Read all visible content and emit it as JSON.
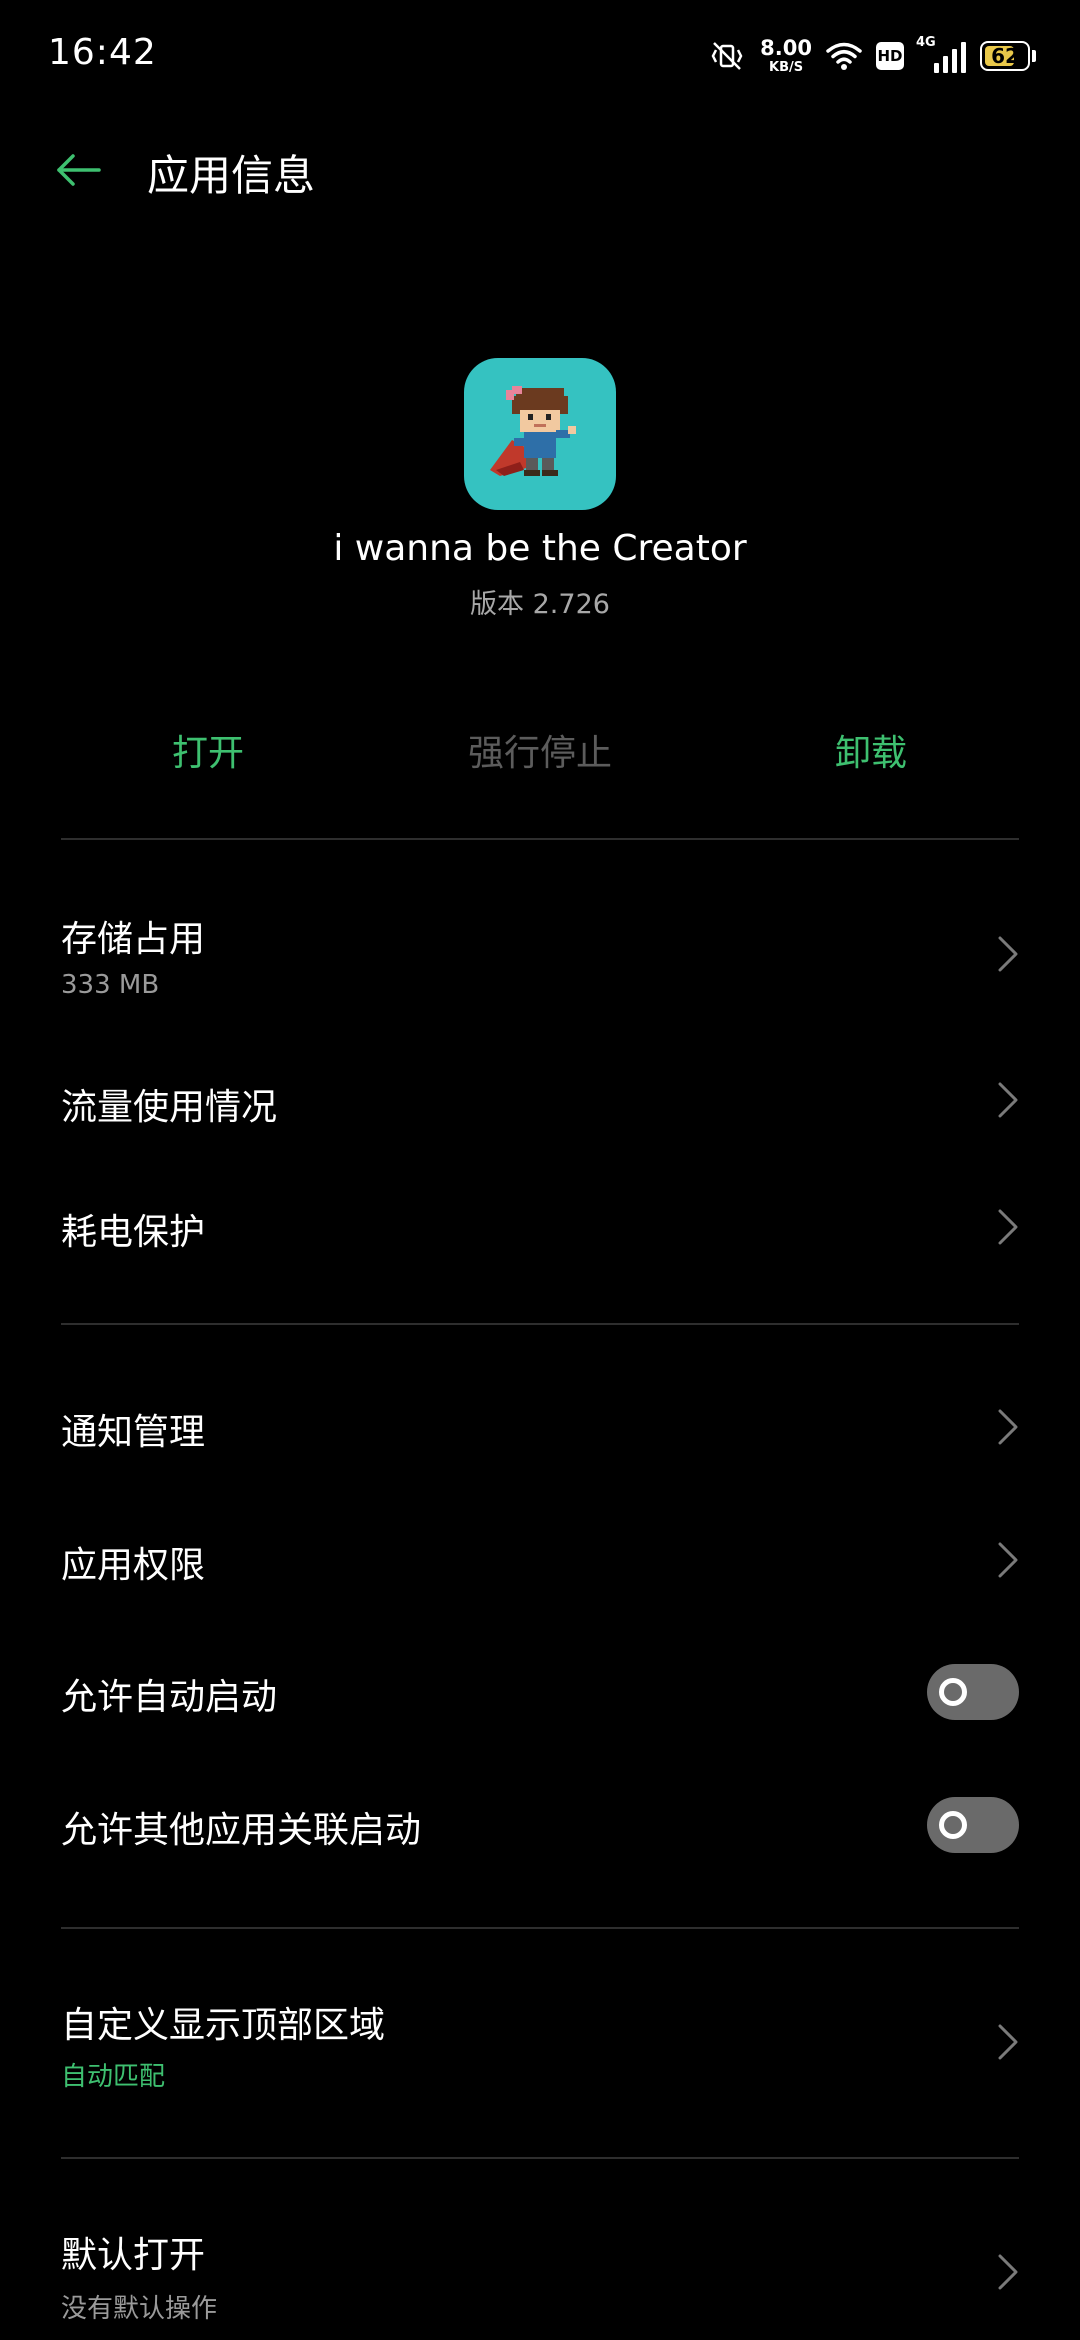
{
  "status_bar": {
    "time": "16:42",
    "net_speed_value": "8.00",
    "net_speed_unit": "KB/S",
    "hd_label": "HD",
    "network_type": "4G",
    "battery_level": "62"
  },
  "header": {
    "title": "应用信息"
  },
  "app": {
    "name": "i wanna be the Creator",
    "version": "版本 2.726"
  },
  "actions": {
    "open": "打开",
    "force_stop": "强行停止",
    "uninstall": "卸载"
  },
  "rows": {
    "storage": {
      "title": "存储占用",
      "subtitle": "333 MB"
    },
    "data_usage": {
      "title": "流量使用情况"
    },
    "battery_protect": {
      "title": "耗电保护"
    },
    "notifications": {
      "title": "通知管理"
    },
    "permissions": {
      "title": "应用权限"
    },
    "auto_start": {
      "title": "允许自动启动",
      "enabled": false
    },
    "associated_start": {
      "title": "允许其他应用关联启动",
      "enabled": false
    },
    "top_area": {
      "title": "自定义显示顶部区域",
      "subtitle": "自动匹配"
    },
    "default_open": {
      "title": "默认打开",
      "subtitle": "没有默认操作"
    }
  },
  "colors": {
    "accent": "#3ec070",
    "background": "#000000",
    "divider": "#2e2e2e",
    "app_icon_bg": "#35c2c1",
    "toggle_off": "#6a6a6a"
  }
}
